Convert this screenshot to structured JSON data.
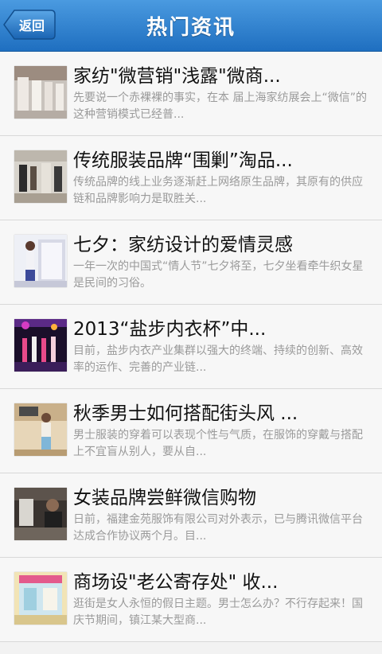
{
  "header": {
    "title": "热门资讯",
    "back_label": "返回"
  },
  "articles": [
    {
      "title": "家纺\"微营销\"浅露\"微商...",
      "summary": "先要说一个赤裸裸的事实，在本 届上海家纺展会上“微信”的这种营销模式已经普..."
    },
    {
      "title": "传统服装品牌“围剿”淘品...",
      "summary": "传统品牌的线上业务逐渐赶上网络原生品牌，其原有的供应链和品牌影响力是取胜关..."
    },
    {
      "title": "七夕：家纺设计的爱情灵感",
      "summary": "一年一次的中国式“情人节”七夕将至，七夕坐看牵牛织女星是民间的习俗。"
    },
    {
      "title": "2013“盐步内衣杯”中...",
      "summary": "目前，盐步内衣产业集群以强大的终端、持续的创新、高效率的运作、完善的产业链..."
    },
    {
      "title": "秋季男士如何搭配街头风 ...",
      "summary": "男士服装的穿着可以表现个性与气质，在服饰的穿戴与搭配上不宜盲从别人，要从自..."
    },
    {
      "title": "女装品牌尝鲜微信购物",
      "summary": "日前，福建金苑服饰有限公司对外表示，已与腾讯微信平台达成合作协议两个月。目..."
    },
    {
      "title": "商场设\"老公寄存处\" 收...",
      "summary": "逛街是女人永恒的假日主题。男士怎么办？不行存起来！国庆节期间，镇江某大型商..."
    }
  ]
}
